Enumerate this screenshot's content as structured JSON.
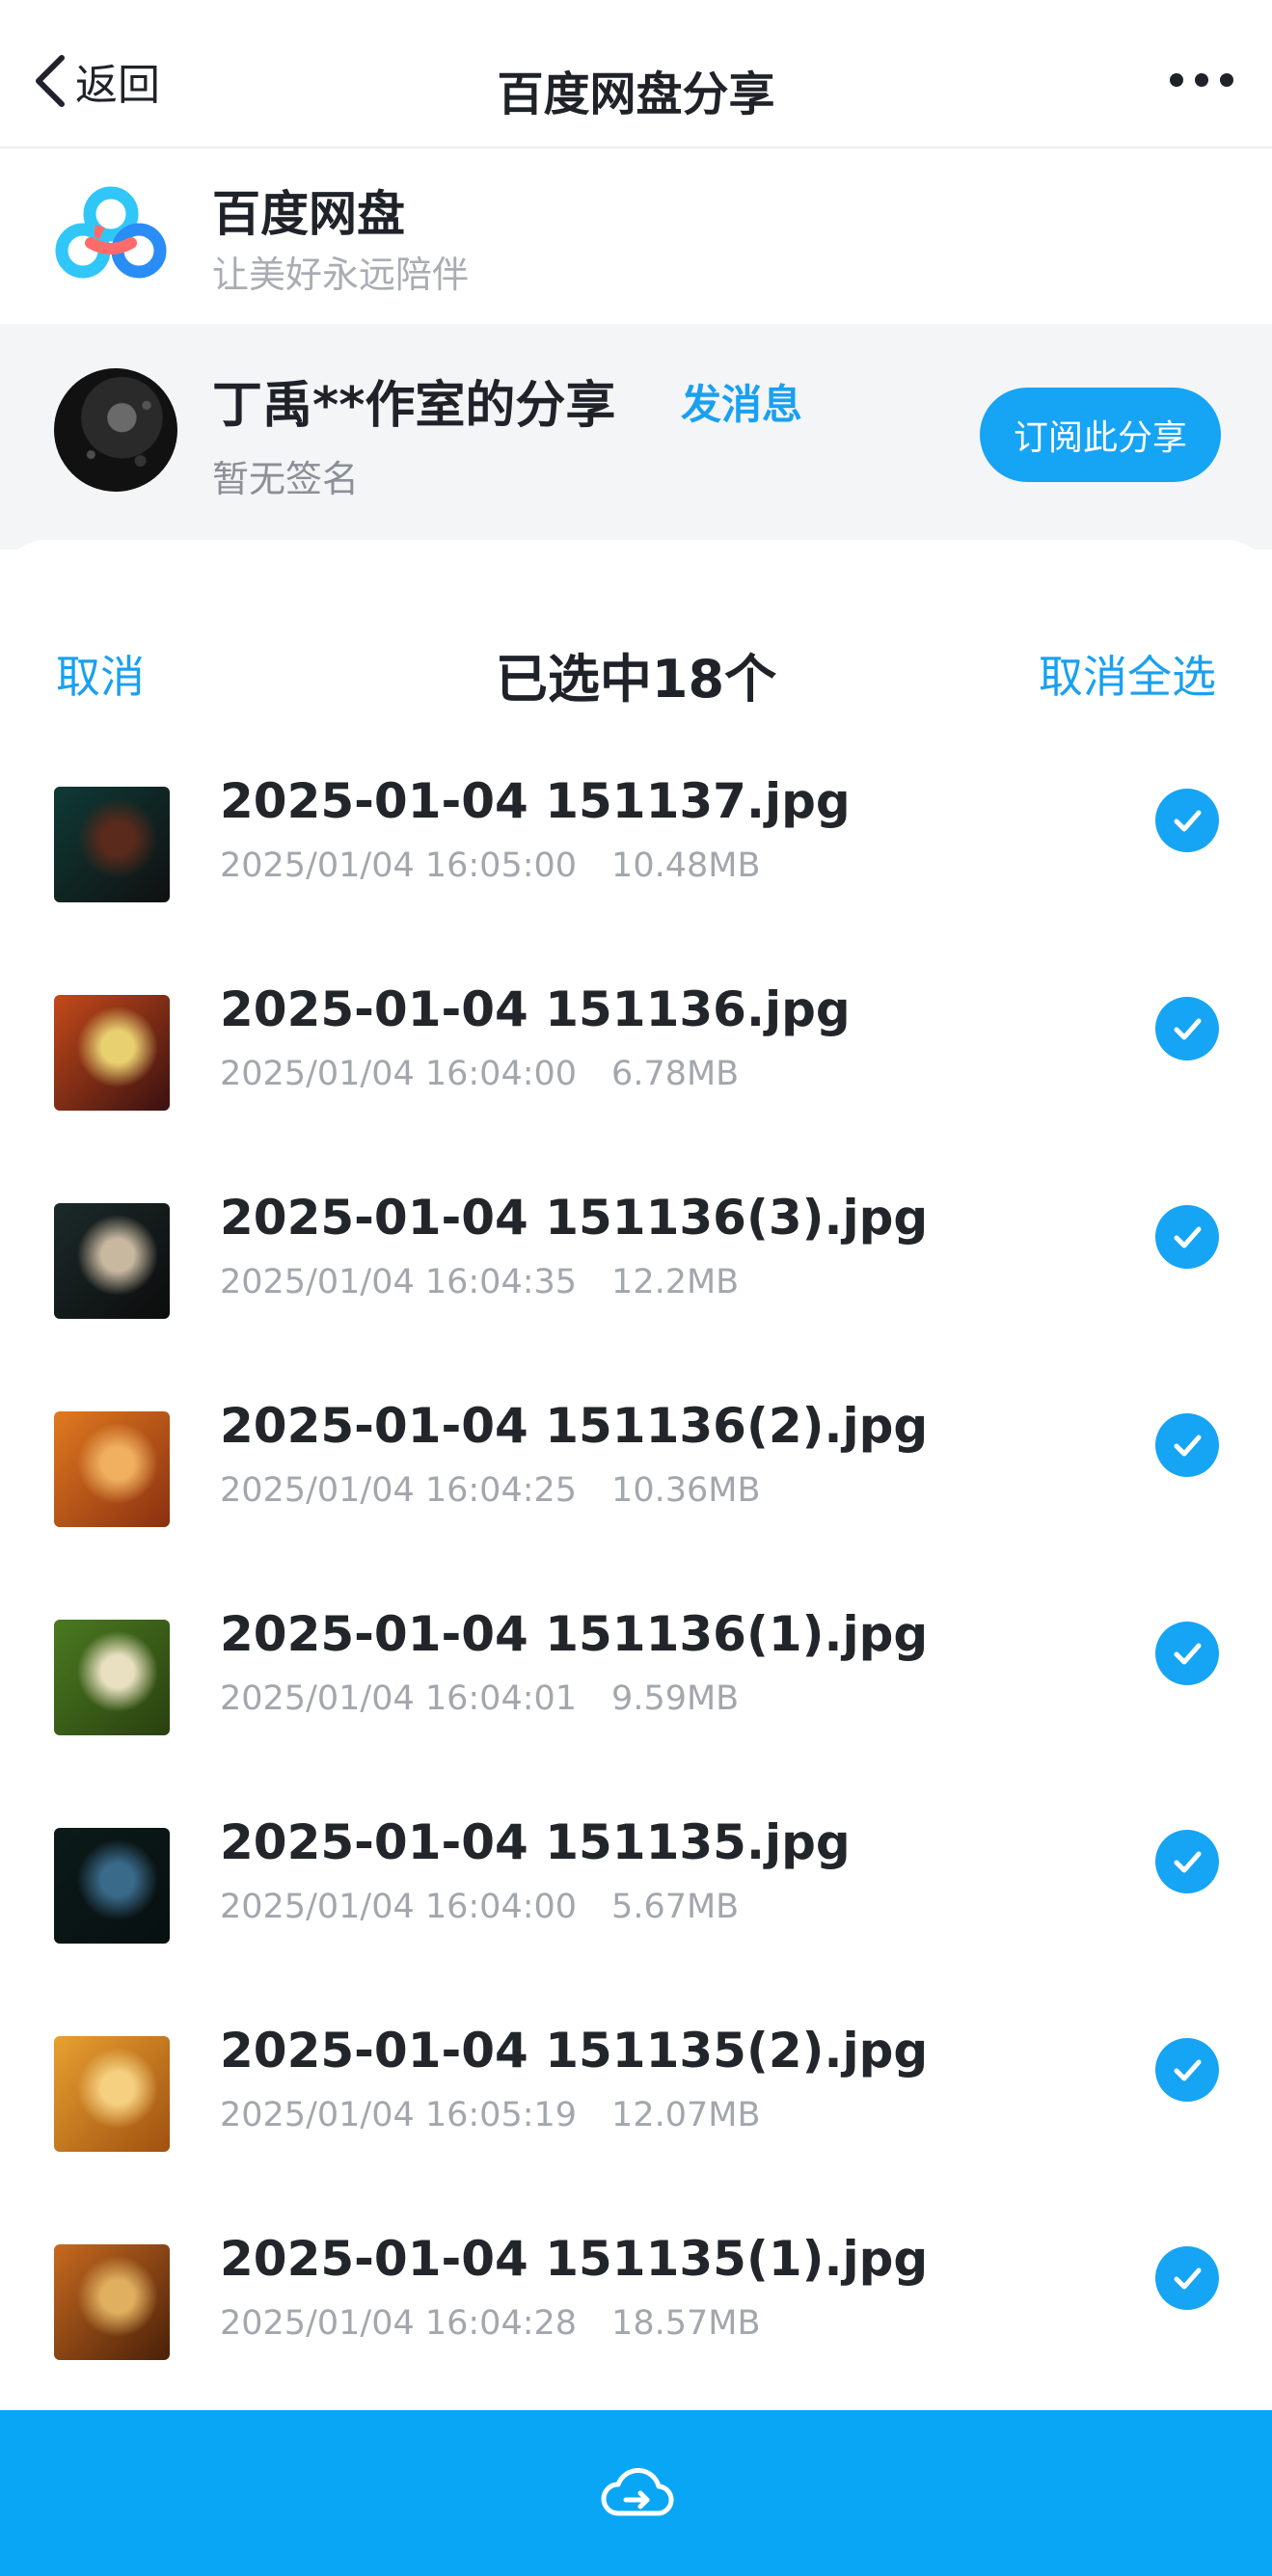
{
  "nav": {
    "back_label": "返回",
    "title": "百度网盘分享",
    "more_icon": "more-dots-icon"
  },
  "app": {
    "name": "百度网盘",
    "slogan": "让美好永远陪伴",
    "logo_colors": [
      "#30c7f8",
      "#ff6b6b",
      "#2a8cf5"
    ]
  },
  "sharer": {
    "name": "丁禹**作室的分享",
    "send_message": "发消息",
    "signature": "暂无签名",
    "subscribe_label": "订阅此分享"
  },
  "selection": {
    "cancel_label": "取消",
    "count_label": "已选中18个",
    "deselect_all_label": "取消全选"
  },
  "files": [
    {
      "name": "2025-01-04 151137.jpg",
      "date": "2025/01/04 16:05:00",
      "size": "10.48MB",
      "checked": true,
      "thumb": [
        "#0f3a36",
        "#5a2a1c",
        "#101010"
      ]
    },
    {
      "name": "2025-01-04 151136.jpg",
      "date": "2025/01/04 16:04:00",
      "size": "6.78MB",
      "checked": true,
      "thumb": [
        "#c44a1a",
        "#e8d070",
        "#3a1010"
      ]
    },
    {
      "name": "2025-01-04 151136(3).jpg",
      "date": "2025/01/04 16:04:35",
      "size": "12.2MB",
      "checked": true,
      "thumb": [
        "#1c2a2a",
        "#c8b8a0",
        "#0c0c0c"
      ]
    },
    {
      "name": "2025-01-04 151136(2).jpg",
      "date": "2025/01/04 16:04:25",
      "size": "10.36MB",
      "checked": true,
      "thumb": [
        "#e07a20",
        "#f0b060",
        "#8a3010"
      ]
    },
    {
      "name": "2025-01-04 151136(1).jpg",
      "date": "2025/01/04 16:04:01",
      "size": "9.59MB",
      "checked": true,
      "thumb": [
        "#4a7a20",
        "#e8e0c0",
        "#2a4010"
      ]
    },
    {
      "name": "2025-01-04 151135.jpg",
      "date": "2025/01/04 16:04:00",
      "size": "5.67MB",
      "checked": true,
      "thumb": [
        "#0c1a1a",
        "#3a6a8a",
        "#081010"
      ]
    },
    {
      "name": "2025-01-04 151135(2).jpg",
      "date": "2025/01/04 16:05:19",
      "size": "12.07MB",
      "checked": true,
      "thumb": [
        "#e8a030",
        "#f5d080",
        "#a05010"
      ]
    },
    {
      "name": "2025-01-04 151135(1).jpg",
      "date": "2025/01/04 16:04:28",
      "size": "18.57MB",
      "checked": true,
      "thumb": [
        "#c86a20",
        "#e0b060",
        "#4a2008"
      ]
    }
  ],
  "save_bar": {
    "icon": "cloud-upload-icon"
  },
  "colors": {
    "accent": "#16a4f5",
    "link": "#1aa0f0",
    "bottom_bar": "#0aa6f6"
  }
}
